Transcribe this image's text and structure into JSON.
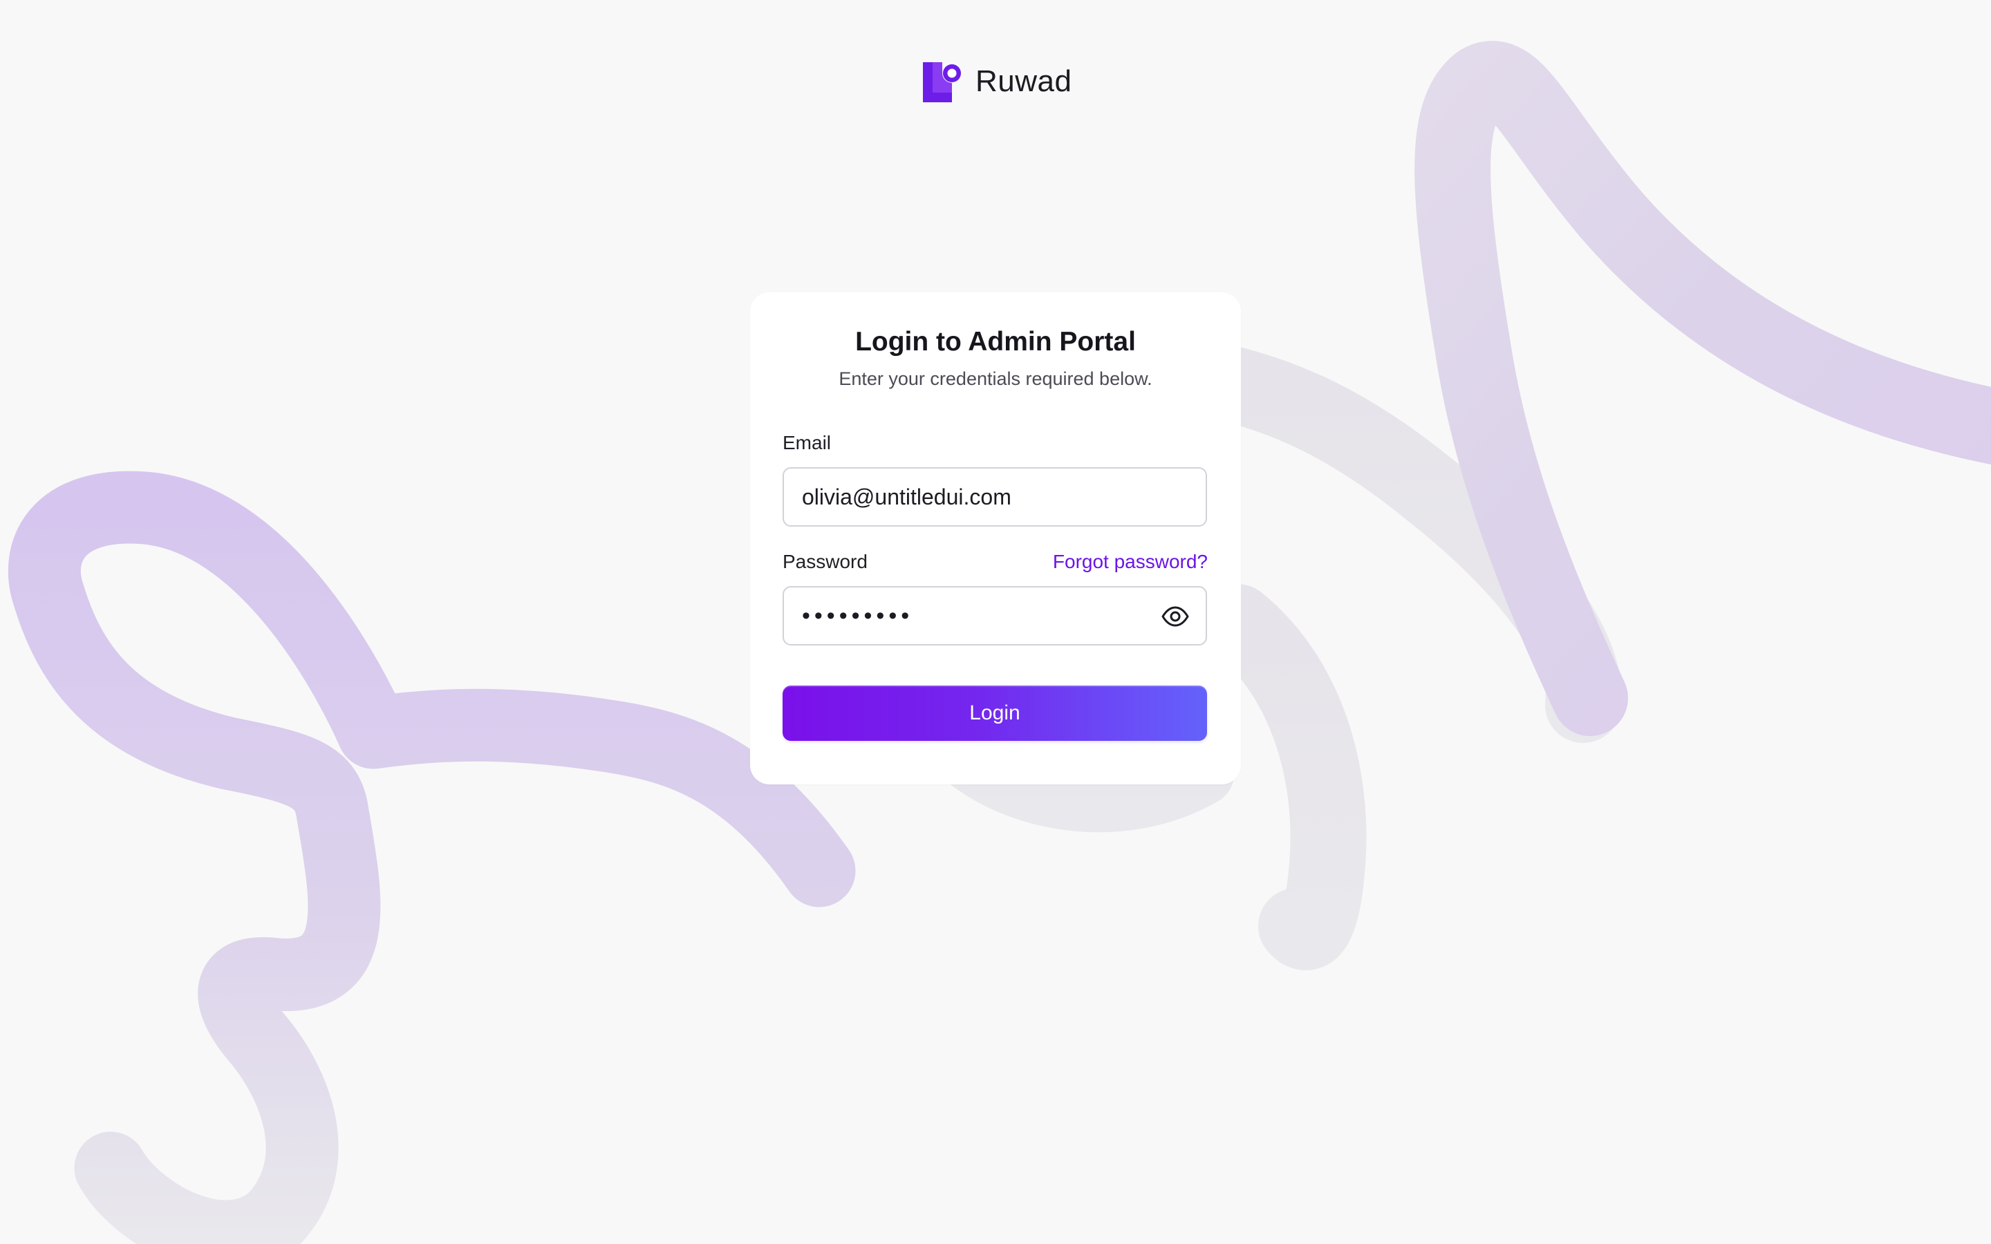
{
  "brand": {
    "name": "Ruwad"
  },
  "login": {
    "title": "Login to Admin Portal",
    "subtitle": "Enter your credentials required below.",
    "email_label": "Email",
    "email_value": "olivia@untitledui.com",
    "password_label": "Password",
    "password_value": "password1",
    "forgot_label": "Forgot password?",
    "submit_label": "Login"
  },
  "icons": {
    "show_password": "eye-icon",
    "logo": "ruwad-logo-icon"
  },
  "colors": {
    "accent": "#6a14e6",
    "button_start": "#7a10ea",
    "button_end": "#6462fb",
    "background": "#f8f8f8"
  }
}
